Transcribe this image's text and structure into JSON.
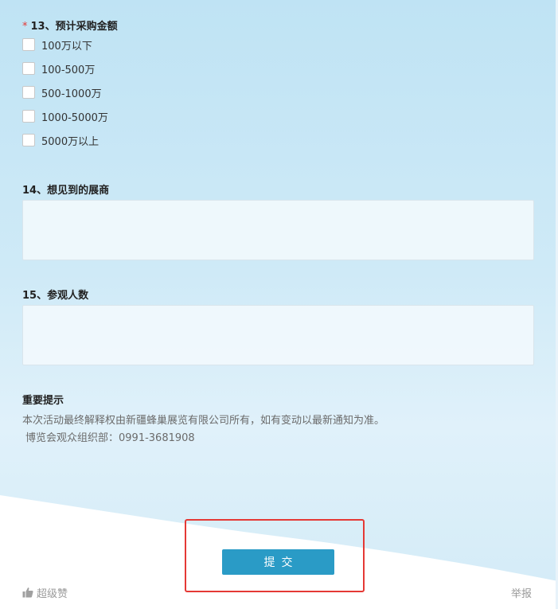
{
  "q13": {
    "required_mark": "*",
    "title": "13、预计采购金额",
    "options": [
      "100万以下",
      "100-500万",
      "500-1000万",
      "1000-5000万",
      "5000万以上"
    ]
  },
  "q14": {
    "title": "14、想见到的展商",
    "value": ""
  },
  "q15": {
    "title": "15、参观人数",
    "value": ""
  },
  "notice": {
    "title": "重要提示",
    "line1": "本次活动最终解释权由新疆蜂巢展览有限公司所有，如有变动以最新通知为准。",
    "line2": "博览会观众组织部：0991-3681908"
  },
  "submit_label": "提交",
  "footer": {
    "like_label": "超级赞",
    "like_icon": "thumbs-up-icon",
    "report_label": "举报"
  },
  "colors": {
    "accent": "#2a9bc6",
    "required": "#e53935",
    "highlight": "#e53935"
  }
}
